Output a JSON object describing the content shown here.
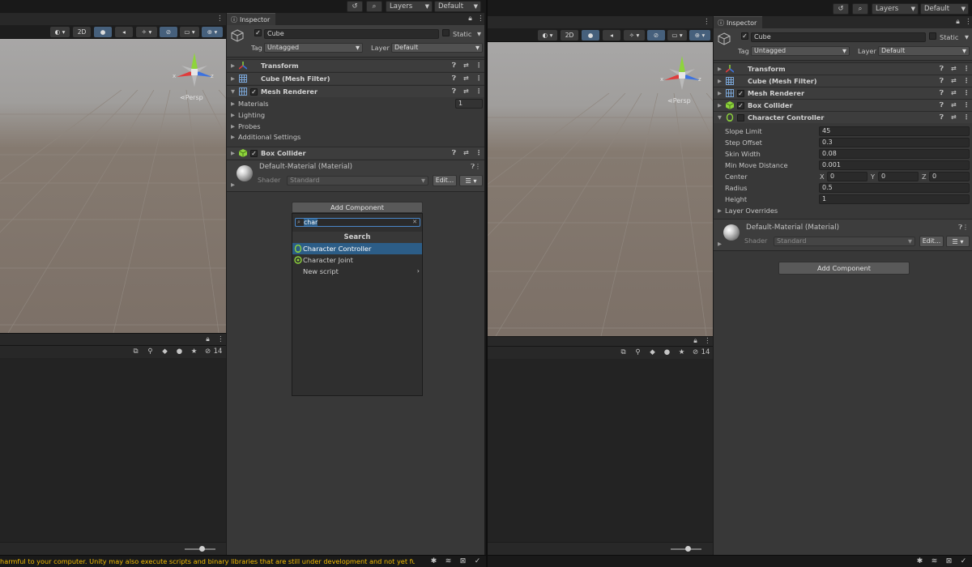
{
  "toolbar": {
    "layers_label": "Layers",
    "layout_label": "Default"
  },
  "scene": {
    "mode_2d": "2D",
    "persp_label": "Persp",
    "axis_x": "x",
    "axis_z": "z"
  },
  "console": {
    "hidden_count": "14"
  },
  "inspector": {
    "tab_label": "Inspector",
    "object_name": "Cube",
    "static_label": "Static",
    "tag_label": "Tag",
    "tag_value": "Untagged",
    "layer_label": "Layer",
    "layer_value": "Default"
  },
  "left_panel": {
    "components": [
      "Transform",
      "Cube (Mesh Filter)",
      "Mesh Renderer"
    ],
    "mesh_renderer_sections": [
      "Materials",
      "Lighting",
      "Probes",
      "Additional Settings"
    ],
    "materials_count": "1",
    "box_collider": "Box Collider",
    "material": {
      "name": "Default-Material (Material)",
      "shader_label": "Shader",
      "shader_value": "Standard",
      "edit_label": "Edit..."
    },
    "add_component_label": "Add Component",
    "search_query": "char",
    "popup_section": "Search",
    "popup_items": [
      "Character Controller",
      "Character Joint",
      "New script"
    ]
  },
  "right_panel": {
    "components": [
      "Transform",
      "Cube (Mesh Filter)",
      "Mesh Renderer",
      "Box Collider",
      "Character Controller"
    ],
    "properties": [
      {
        "label": "Slope Limit",
        "value": "45"
      },
      {
        "label": "Step Offset",
        "value": "0.3"
      },
      {
        "label": "Skin Width",
        "value": "0.08"
      },
      {
        "label": "Min Move Distance",
        "value": "0.001"
      }
    ],
    "center": {
      "label": "Center",
      "x_label": "X",
      "x": "0",
      "y_label": "Y",
      "y": "0",
      "z_label": "Z",
      "z": "0"
    },
    "properties_2": [
      {
        "label": "Radius",
        "value": "0.5"
      },
      {
        "label": "Height",
        "value": "1"
      }
    ],
    "layer_overrides": "Layer Overrides",
    "material": {
      "name": "Default-Material (Material)",
      "shader_label": "Shader",
      "shader_value": "Standard",
      "edit_label": "Edit..."
    },
    "add_component_label": "Add Component"
  },
  "status_bar": {
    "message": "harmful to your computer. Unity may also execute scripts and binary libraries that are still under development and not yet fully teste"
  },
  "colors": {
    "accent_blue": "#2c5d87",
    "warning_yellow": "#f4bc02",
    "panel_bg": "#383838"
  },
  "icons": [
    "history-icon",
    "search-icon",
    "lock-icon",
    "menu-icon",
    "help-icon",
    "preset-icon",
    "more-icon",
    "cube-icon",
    "transform-icon",
    "mesh-filter-icon",
    "mesh-renderer-icon",
    "box-collider-icon",
    "character-controller-icon",
    "character-joint-icon"
  ]
}
